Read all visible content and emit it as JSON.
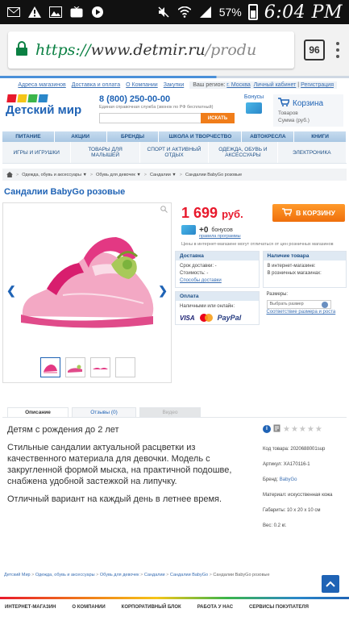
{
  "status_bar": {
    "battery": "57%",
    "time": "6:04 PM",
    "icons": [
      "mail-icon",
      "warning-icon",
      "image-icon",
      "tv-icon",
      "play-icon",
      "mute-icon",
      "wifi-icon",
      "cellular-icon"
    ]
  },
  "browser": {
    "scheme": "https://",
    "url_host": "www.detmir.ru",
    "url_rest": "/produ",
    "tabs_count": "96",
    "lock_color": "#0b8043"
  },
  "top_links": {
    "items": [
      "Адреса магазинов",
      "Доставка и оплата",
      "О Компании",
      "Закупки"
    ],
    "region_label": "Ваш регион:",
    "region_value": "г. Москва",
    "cabinet": "Личный кабинет",
    "separator": "|",
    "register": "Регистрация"
  },
  "header": {
    "logo_text": "Детский мир",
    "phone": "8 (800) 250-00-00",
    "phone_sub": "Единая справочная служба (звонок по РФ бесплатный)",
    "search_button": "ИСКАТЬ",
    "bonus_title": "Бонусы",
    "cart_title": "Корзина",
    "cart_goods": "Товаров",
    "cart_sum": "Сумма (руб.)"
  },
  "nav_primary": [
    "Питание",
    "Акции",
    "Бренды",
    "Школа и творчество",
    "Автокресла",
    "Книги"
  ],
  "nav_secondary": [
    "Игры и игрушки",
    "Товары для малышей",
    "Спорт и активный отдых",
    "Одежда, обувь и аксессуары",
    "Электроника"
  ],
  "breadcrumbs": {
    "items": [
      "Одежда, обувь и аксессуары ▼",
      "Обувь для девочек ▼",
      "Сандалии ▼",
      "Сандалии BabyGo розовые"
    ],
    "separator": ">"
  },
  "product": {
    "title": "Сандалии BabyGo розовые",
    "price": "1 699",
    "currency": "руб.",
    "buy_button": "В КОРЗИНУ",
    "bonus_amount": "+0",
    "bonus_label": "бонусов",
    "bonus_rules": "правила программы",
    "price_note": "Цены в интернет-магазине могут отличаться от цен розничных магазинов",
    "delivery": {
      "title": "Доставка",
      "term_label": "Срок доставки:",
      "term_value": "-",
      "cost_label": "Стоимость:",
      "cost_value": "-",
      "methods_link": "Способы доставки"
    },
    "availability": {
      "title": "Наличие товара",
      "online_label": "В интернет-магазине:",
      "retail_label": "В розничных магазинах:"
    },
    "payment": {
      "title": "Оплата",
      "label": "Наличными или онлайн:",
      "visa": "VISA",
      "paypal": "PayPal"
    },
    "sizes": {
      "label": "Размеры:",
      "placeholder": "Выбрать размер",
      "table_link": "Соответствие размера и роста"
    }
  },
  "desc_tabs": [
    "Описание",
    "Отзывы (0)",
    "Видео"
  ],
  "description": {
    "age": "Детям с рождения до 2 лет",
    "text": "Стильные сандалии актуальной расцветки из качественного материала для девочки. Модель с закругленной формой мыска, на практичной подошве, снабжена удобной застежкой на липучку.",
    "extra": "Отличный вариант на каждый день в летнее время."
  },
  "specs": {
    "stars": "★★★★★",
    "code": "Код товара: 2020688001sup",
    "article": "Артикул: XA170116-1",
    "brand_label": "Бренд:",
    "brand_value": "BabyGo",
    "material": "Материал: искусственная кожа",
    "size": "Габариты: 10 x 20 x 10 см",
    "weight": "Вес: 0.2 кг."
  },
  "bottom_breadcrumbs": [
    "Детский Мир",
    "Одежда, обувь и аксессуары",
    "Обувь для девочек",
    "Сандалии",
    "Сандалии BabyGo",
    "Сандалии BabyGo розовые"
  ],
  "footer": [
    "Интернет-магазин",
    "О компании",
    "Корпоративный блок",
    "Работа у нас",
    "Сервисы покупателя"
  ],
  "colors": {
    "brand_blue": "#1f63b5",
    "price_red": "#e8192c",
    "buy_orange": "#f07d1a"
  }
}
